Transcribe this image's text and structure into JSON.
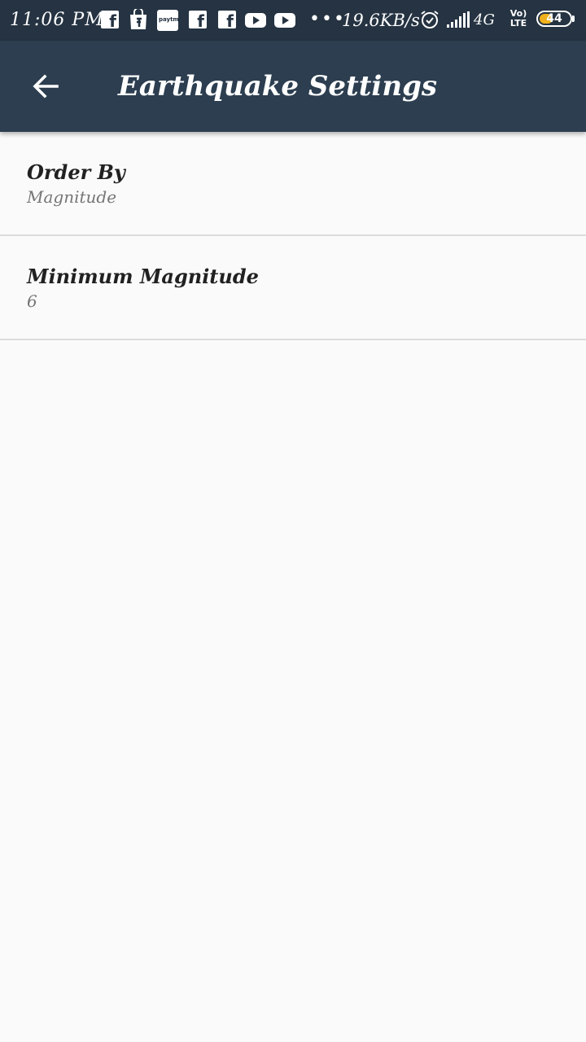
{
  "status_bar": {
    "time": "11:06 PM",
    "net_speed": "19.6KB/s",
    "network_type": "4G",
    "volte_top": "Vo)",
    "volte_bottom": "LTE",
    "battery_level": "44",
    "battery_fraction": 0.44,
    "battery_color": "#f0b11d",
    "paytm_label": "paytm",
    "notification_icons": [
      "facebook-icon",
      "shopping-bag-icon",
      "paytm-icon",
      "facebook-icon",
      "facebook-icon",
      "youtube-icon",
      "youtube-icon"
    ]
  },
  "app_bar": {
    "title": "Earthquake Settings",
    "back_icon": "arrow-left-icon",
    "color": "#2c3e50"
  },
  "preferences": [
    {
      "title": "Order By",
      "summary": "Magnitude"
    },
    {
      "title": "Minimum Magnitude",
      "summary": "6"
    }
  ]
}
